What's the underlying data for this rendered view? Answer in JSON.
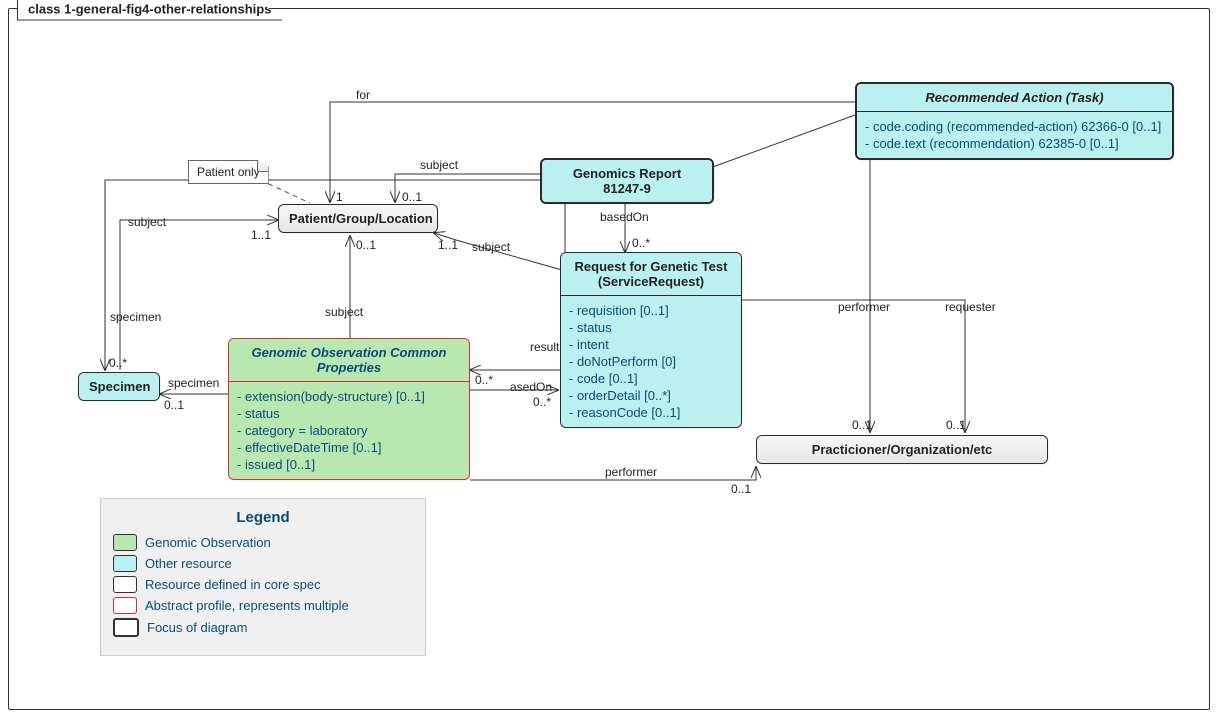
{
  "frame_title": "class 1-general-fig4-other-relationships",
  "note_patient_only": "Patient only",
  "classes": {
    "genomics_report": {
      "title": "Genomics Report 81247-9"
    },
    "recommended_action": {
      "title": "Recommended Action (Task)",
      "items": [
        "code.coding (recommended-action) 62366-0 [0..1]",
        "code.text (recommendation) 62385-0 [0..1]"
      ]
    },
    "patient_group_loc": {
      "title": "Patient/Group/Location"
    },
    "service_request": {
      "title_l1": "Request for Genetic Test",
      "title_l2": "(ServiceRequest)",
      "items": [
        "requisition [0..1]",
        "status",
        "intent",
        "doNotPerform [0]",
        "code [0..1]",
        "orderDetail [0..*]",
        "reasonCode [0..1]"
      ]
    },
    "genomic_obs": {
      "title_l1": "Genomic Observation Common",
      "title_l2": "Properties",
      "items": [
        "extension(body-structure) [0..1]",
        "status",
        "category = laboratory",
        "effectiveDateTime [0..1]",
        "issued [0..1]"
      ]
    },
    "specimen": {
      "title": "Specimen"
    },
    "practitioner": {
      "title": "Practicioner/Organization/etc"
    }
  },
  "labels": {
    "for": "for",
    "subject_gr_pgl": "subject",
    "basedOn": "basedOn",
    "subject_sr_pgl": "subject",
    "subject_spec_pgl": "subject",
    "subject_obs_pgl": "subject",
    "specimen_gr": "specimen",
    "specimen_obs": "specimen",
    "result": "result",
    "asedOn": "asedOn",
    "performer_obs": "performer",
    "performer_task": "performer",
    "requester": "requester"
  },
  "mult": {
    "for_pgl": "1",
    "subject_gr_pgl": "0..1",
    "subject_spec_l": "1..1",
    "basedOn_sr": "0..*",
    "subject_sr_pgl": "1..1",
    "subject_obs_pgl": "0..1",
    "specimen_gr": "0..*",
    "specimen_obs": "0..1",
    "result_obs": "0..*",
    "asedOn_sr": "0..*",
    "performer_obs_r": "0..1",
    "performer_task_b": "0..1",
    "requester_b": "0..1"
  },
  "legend": {
    "title": "Legend",
    "rows": [
      {
        "label": "Genomic Observation",
        "style": "green"
      },
      {
        "label": "Other resource",
        "style": "cyan"
      },
      {
        "label": "Resource defined in core spec",
        "style": "white"
      },
      {
        "label": "Abstract profile, represents multiple",
        "style": "red"
      },
      {
        "label": "Focus of diagram",
        "style": "thick"
      }
    ]
  }
}
